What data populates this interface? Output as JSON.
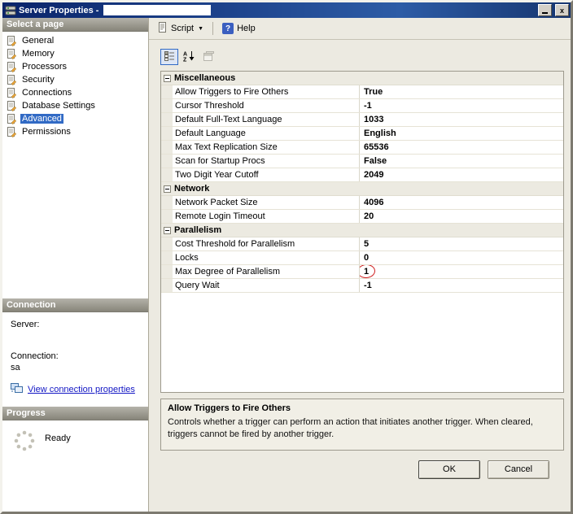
{
  "window": {
    "title": "Server Properties -",
    "icons": {
      "close": "x",
      "dropdown": "6",
      "sort_a": "A",
      "sort_z": "Z",
      "help": "?"
    }
  },
  "toolbar": {
    "script_label": "Script",
    "help_label": "Help"
  },
  "sidebar": {
    "select_page_header": "Select a page",
    "pages": [
      {
        "label": "General"
      },
      {
        "label": "Memory"
      },
      {
        "label": "Processors"
      },
      {
        "label": "Security"
      },
      {
        "label": "Connections"
      },
      {
        "label": "Database Settings"
      },
      {
        "label": "Advanced"
      },
      {
        "label": "Permissions"
      }
    ],
    "connection_header": "Connection",
    "server_label": "Server:",
    "server_value": "",
    "connection_label": "Connection:",
    "connection_value": "sa",
    "view_connection_link": "View connection properties",
    "progress_header": "Progress",
    "progress_status": "Ready"
  },
  "grid": {
    "categories": [
      {
        "name": "Miscellaneous",
        "rows": [
          {
            "label": "Allow Triggers to Fire Others",
            "value": "True"
          },
          {
            "label": "Cursor Threshold",
            "value": "-1"
          },
          {
            "label": "Default Full-Text Language",
            "value": "1033"
          },
          {
            "label": "Default Language",
            "value": "English"
          },
          {
            "label": "Max Text Replication Size",
            "value": "65536"
          },
          {
            "label": "Scan for Startup Procs",
            "value": "False"
          },
          {
            "label": "Two Digit Year Cutoff",
            "value": "2049"
          }
        ]
      },
      {
        "name": "Network",
        "rows": [
          {
            "label": "Network Packet Size",
            "value": "4096"
          },
          {
            "label": "Remote Login Timeout",
            "value": "20"
          }
        ]
      },
      {
        "name": "Parallelism",
        "rows": [
          {
            "label": "Cost Threshold for Parallelism",
            "value": "5"
          },
          {
            "label": "Locks",
            "value": "0"
          },
          {
            "label": "Max Degree of Parallelism",
            "value": "1"
          },
          {
            "label": "Query Wait",
            "value": "-1"
          }
        ]
      }
    ],
    "description": {
      "title": "Allow Triggers to Fire Others",
      "text": "Controls whether a trigger can perform an action that initiates another trigger. When cleared, triggers cannot be fired by another trigger."
    }
  },
  "buttons": {
    "ok": "OK",
    "cancel": "Cancel"
  }
}
